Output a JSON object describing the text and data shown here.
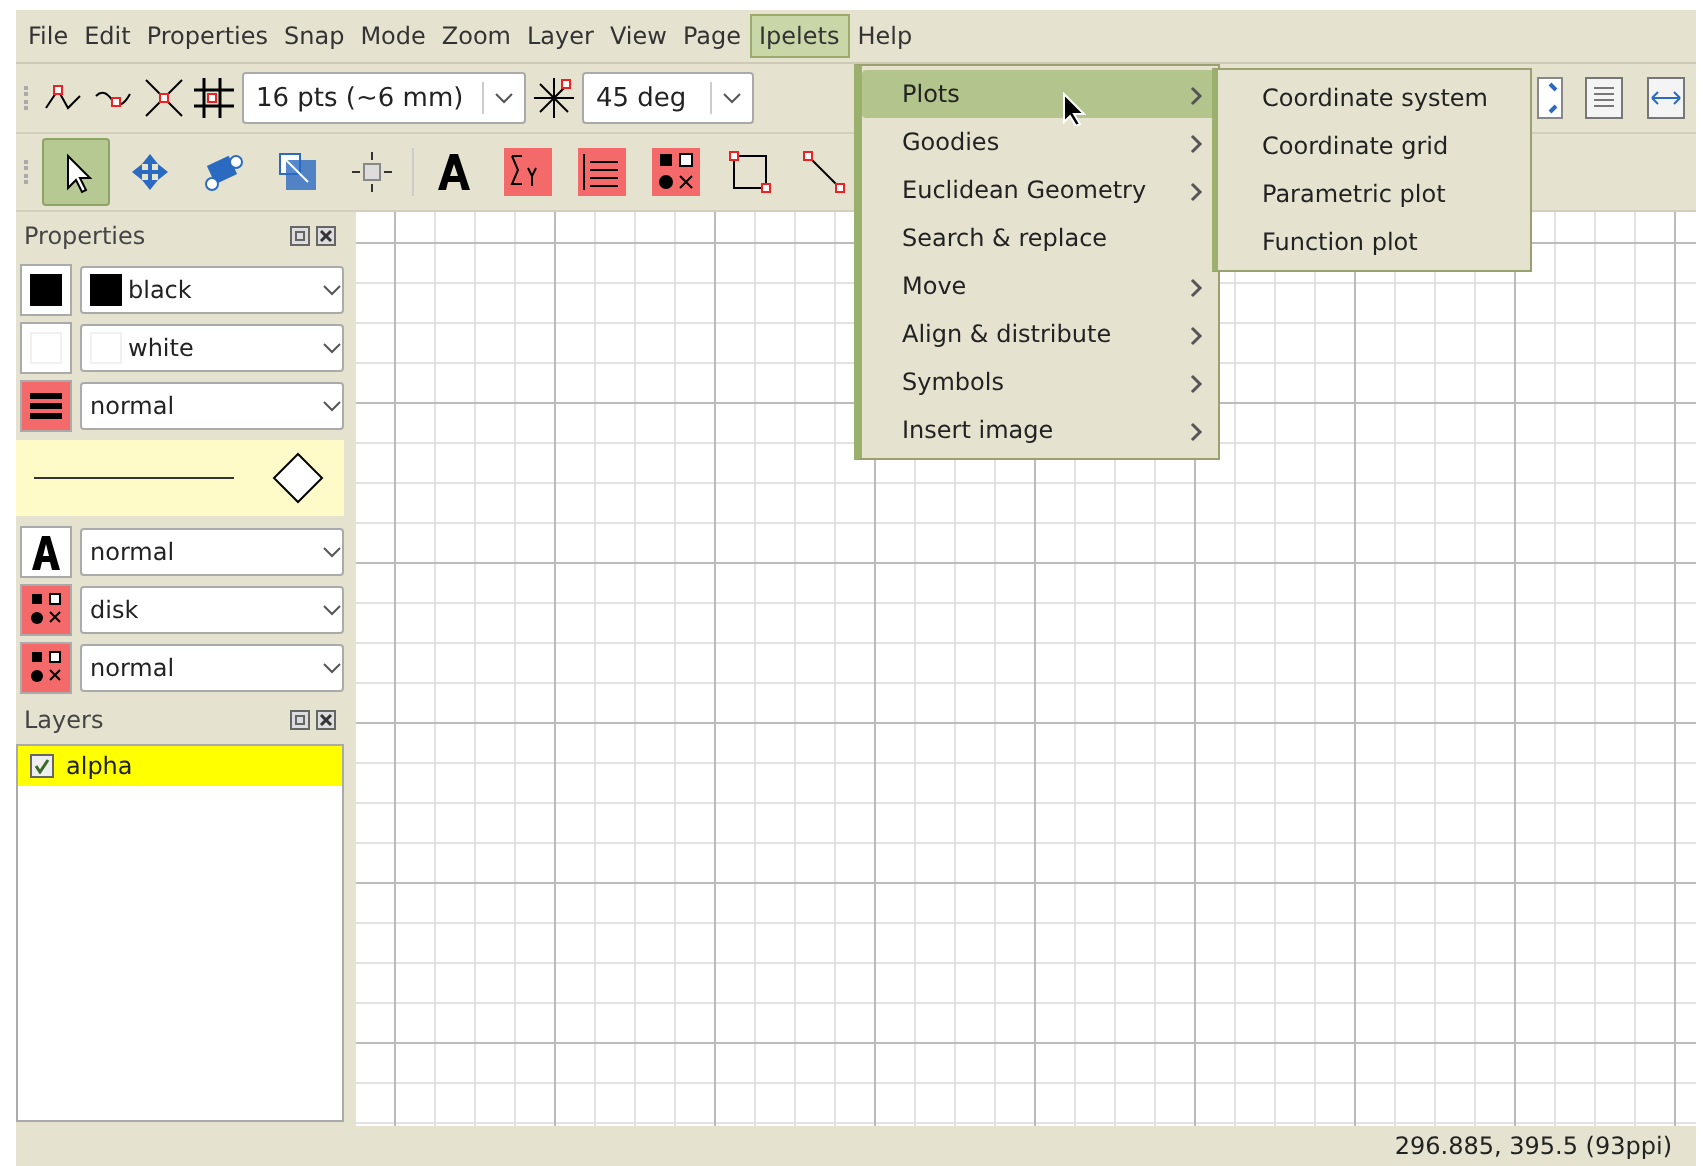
{
  "menubar": [
    {
      "label": "File",
      "selected": false
    },
    {
      "label": "Edit",
      "selected": false
    },
    {
      "label": "Properties",
      "selected": false
    },
    {
      "label": "Snap",
      "selected": false
    },
    {
      "label": "Mode",
      "selected": false
    },
    {
      "label": "Zoom",
      "selected": false
    },
    {
      "label": "Layer",
      "selected": false
    },
    {
      "label": "View",
      "selected": false
    },
    {
      "label": "Page",
      "selected": false
    },
    {
      "label": "Ipelets",
      "selected": true
    },
    {
      "label": "Help",
      "selected": false
    }
  ],
  "snap_toolbar": {
    "grid_size": "16 pts (~6 mm)",
    "angle": "45 deg"
  },
  "mode_toolbar": [
    {
      "kind": "select",
      "selected": true
    },
    {
      "kind": "translate",
      "selected": false
    },
    {
      "kind": "rotate",
      "selected": false
    },
    {
      "kind": "stretch",
      "selected": false
    },
    {
      "kind": "pan",
      "selected": false
    },
    {
      "kind": "text",
      "selected": false
    },
    {
      "kind": "math",
      "selected": false
    },
    {
      "kind": "paragraph",
      "selected": false
    },
    {
      "kind": "marks",
      "selected": false
    },
    {
      "kind": "rectangle",
      "selected": false
    },
    {
      "kind": "line",
      "selected": false
    }
  ],
  "properties": {
    "title": "Properties",
    "rows": [
      {
        "kind": "color",
        "color": "#000000",
        "value": "black"
      },
      {
        "kind": "color",
        "color": "#ffffff",
        "value": "white"
      },
      {
        "kind": "pen",
        "value": "normal"
      },
      {
        "kind": "arrows"
      },
      {
        "kind": "textsize",
        "value": "normal"
      },
      {
        "kind": "markshape",
        "value": "disk"
      },
      {
        "kind": "marksize",
        "value": "normal"
      }
    ]
  },
  "layers": {
    "title": "Layers",
    "items": [
      {
        "name": "alpha",
        "checked": true,
        "selected": true
      }
    ]
  },
  "ipelets_menu": [
    {
      "label": "Plots",
      "submenu": true,
      "selected": true
    },
    {
      "label": "Goodies",
      "submenu": true,
      "selected": false
    },
    {
      "label": "Euclidean Geometry",
      "submenu": true,
      "selected": false
    },
    {
      "label": "Search & replace",
      "submenu": false,
      "selected": false
    },
    {
      "label": "Move",
      "submenu": true,
      "selected": false
    },
    {
      "label": "Align & distribute",
      "submenu": true,
      "selected": false
    },
    {
      "label": "Symbols",
      "submenu": true,
      "selected": false
    },
    {
      "label": "Insert image",
      "submenu": true,
      "selected": false
    }
  ],
  "plots_submenu": [
    "Coordinate system",
    "Coordinate grid",
    "Parametric plot",
    "Function plot"
  ],
  "status_bar": "296.885, 395.5 (93ppi)"
}
